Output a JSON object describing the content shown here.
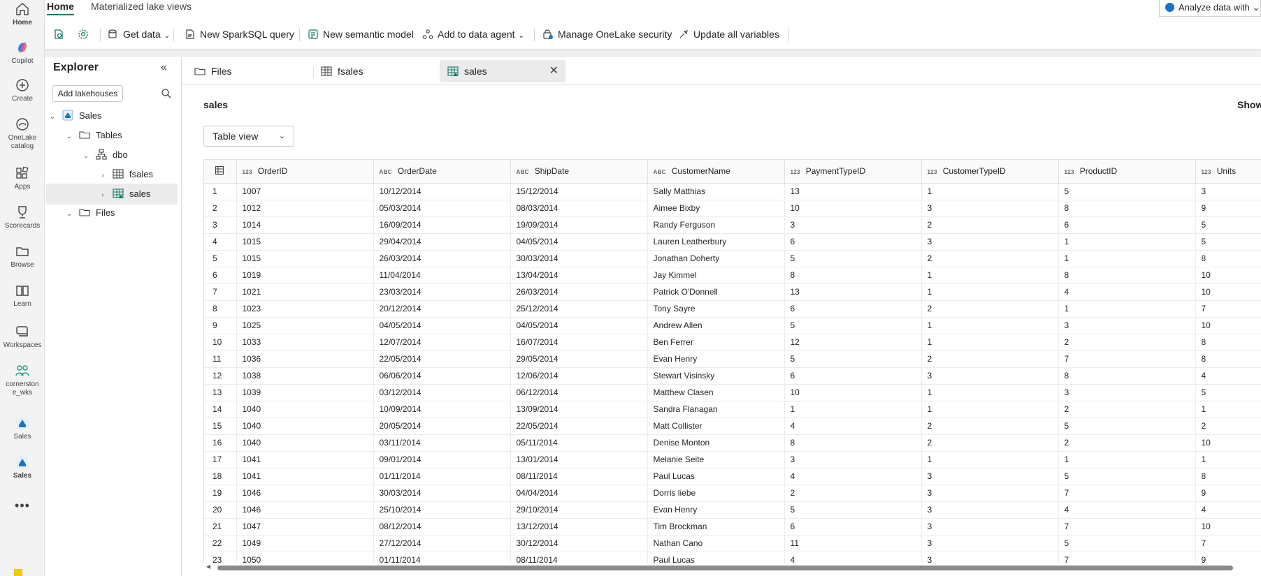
{
  "rail": [
    {
      "label": "Home",
      "icon": "home-icon"
    },
    {
      "label": "Copilot",
      "icon": "copilot-icon"
    },
    {
      "label": "Create",
      "icon": "create-icon"
    },
    {
      "label": "OneLake catalog",
      "icon": "onelake-icon"
    },
    {
      "label": "Apps",
      "icon": "apps-icon"
    },
    {
      "label": "Scorecards",
      "icon": "trophy-icon"
    },
    {
      "label": "Browse",
      "icon": "folder-icon"
    },
    {
      "label": "Learn",
      "icon": "book-icon"
    },
    {
      "label": "Workspaces",
      "icon": "workspaces-icon"
    },
    {
      "label": "cornerstone_wks",
      "icon": "workspace-people-icon"
    },
    {
      "label": "Sales",
      "icon": "lakehouse-icon"
    },
    {
      "label": "Sales",
      "icon": "lakehouse-icon"
    }
  ],
  "rail_more": "•••",
  "top_tabs": {
    "home": "Home",
    "mlv": "Materialized lake views",
    "analyze": "Analyze data with",
    "analyze_chev": "⌄"
  },
  "ribbon": {
    "get_data": "Get data",
    "new_sql": "New SparkSQL query",
    "new_model": "New semantic model",
    "add_agent": "Add to data agent",
    "manage_security": "Manage OneLake security",
    "update_vars": "Update all variables",
    "chevron": "⌄"
  },
  "explorer": {
    "title": "Explorer",
    "collapse_glyph": "«",
    "add_lakehouses": "Add lakehouses",
    "tree": {
      "sales": "Sales",
      "tables": "Tables",
      "dbo": "dbo",
      "fsales": "fsales",
      "sales_tbl": "sales",
      "files": "Files"
    }
  },
  "doc_tabs": {
    "files": "Files",
    "fsales": "fsales",
    "sales": "sales",
    "close": "✕"
  },
  "table_title": "sales",
  "showing": "Showing",
  "view_select": {
    "value": "Table view",
    "chev": "⌄"
  },
  "columns": [
    {
      "type": "123",
      "name": "OrderID"
    },
    {
      "type": "ABC",
      "name": "OrderDate"
    },
    {
      "type": "ABC",
      "name": "ShipDate"
    },
    {
      "type": "ABC",
      "name": "CustomerName"
    },
    {
      "type": "123",
      "name": "PaymentTypeID"
    },
    {
      "type": "123",
      "name": "CustomerTypeID"
    },
    {
      "type": "123",
      "name": "ProductID"
    },
    {
      "type": "123",
      "name": "Units"
    }
  ],
  "rows": [
    [
      "1",
      "1007",
      "10/12/2014",
      "15/12/2014",
      "Sally Matthias",
      "13",
      "1",
      "5",
      "3"
    ],
    [
      "2",
      "1012",
      "05/03/2014",
      "08/03/2014",
      "Aimee Bixby",
      "10",
      "3",
      "8",
      "9"
    ],
    [
      "3",
      "1014",
      "16/09/2014",
      "19/09/2014",
      "Randy Ferguson",
      "3",
      "2",
      "6",
      "5"
    ],
    [
      "4",
      "1015",
      "29/04/2014",
      "04/05/2014",
      "Lauren Leatherbury",
      "6",
      "3",
      "1",
      "5"
    ],
    [
      "5",
      "1015",
      "26/03/2014",
      "30/03/2014",
      "Jonathan Doherty",
      "5",
      "2",
      "1",
      "8"
    ],
    [
      "6",
      "1019",
      "11/04/2014",
      "13/04/2014",
      "Jay Kimmel",
      "8",
      "1",
      "8",
      "10"
    ],
    [
      "7",
      "1021",
      "23/03/2014",
      "26/03/2014",
      "Patrick O'Donnell",
      "13",
      "1",
      "4",
      "10"
    ],
    [
      "8",
      "1023",
      "20/12/2014",
      "25/12/2014",
      "Tony Sayre",
      "6",
      "2",
      "1",
      "7"
    ],
    [
      "9",
      "1025",
      "04/05/2014",
      "04/05/2014",
      "Andrew Allen",
      "5",
      "1",
      "3",
      "10"
    ],
    [
      "10",
      "1033",
      "12/07/2014",
      "16/07/2014",
      "Ben Ferrer",
      "12",
      "1",
      "2",
      "8"
    ],
    [
      "11",
      "1036",
      "22/05/2014",
      "29/05/2014",
      "Evan Henry",
      "5",
      "2",
      "7",
      "8"
    ],
    [
      "12",
      "1038",
      "06/06/2014",
      "12/06/2014",
      "Stewart Visinsky",
      "6",
      "3",
      "8",
      "4"
    ],
    [
      "13",
      "1039",
      "03/12/2014",
      "06/12/2014",
      "Matthew Clasen",
      "10",
      "1",
      "3",
      "5"
    ],
    [
      "14",
      "1040",
      "10/09/2014",
      "13/09/2014",
      "Sandra Flanagan",
      "1",
      "1",
      "2",
      "1"
    ],
    [
      "15",
      "1040",
      "20/05/2014",
      "22/05/2014",
      "Matt Collister",
      "4",
      "2",
      "5",
      "2"
    ],
    [
      "16",
      "1040",
      "03/11/2014",
      "05/11/2014",
      "Denise Monton",
      "8",
      "2",
      "2",
      "10"
    ],
    [
      "17",
      "1041",
      "09/01/2014",
      "13/01/2014",
      "Melanie Seite",
      "3",
      "1",
      "1",
      "1"
    ],
    [
      "18",
      "1041",
      "01/11/2014",
      "08/11/2014",
      "Paul Lucas",
      "4",
      "3",
      "5",
      "8"
    ],
    [
      "19",
      "1046",
      "30/03/2014",
      "04/04/2014",
      "Dorris liebe",
      "2",
      "3",
      "7",
      "9"
    ],
    [
      "20",
      "1046",
      "25/10/2014",
      "29/10/2014",
      "Evan Henry",
      "5",
      "3",
      "4",
      "4"
    ],
    [
      "21",
      "1047",
      "08/12/2014",
      "13/12/2014",
      "Tim Brockman",
      "6",
      "3",
      "7",
      "10"
    ],
    [
      "22",
      "1049",
      "27/12/2014",
      "30/12/2014",
      "Nathan Cano",
      "11",
      "3",
      "5",
      "7"
    ],
    [
      "23",
      "1050",
      "01/11/2014",
      "08/11/2014",
      "Paul Lucas",
      "4",
      "3",
      "7",
      "9"
    ]
  ],
  "colors": {
    "accent": "#117865",
    "lakehouse": "#1a73c9",
    "table_icon": "#117865"
  }
}
